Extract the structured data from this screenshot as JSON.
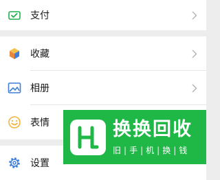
{
  "menu": {
    "items": [
      {
        "label": "支付",
        "icon": "wallet-check-icon",
        "color": "#21b24b"
      },
      {
        "label": "收藏",
        "icon": "cube-icon",
        "color": "#e8a23c"
      },
      {
        "label": "相册",
        "icon": "photo-icon",
        "color": "#3f7fd8"
      },
      {
        "label": "表情",
        "icon": "smiley-icon",
        "color": "#f0b43c"
      },
      {
        "label": "设置",
        "icon": "gear-icon",
        "color": "#3f7fd8"
      }
    ]
  },
  "watermark": {
    "title": "换换回收",
    "subtitle_chars": [
      "旧",
      "手",
      "机",
      "换",
      "钱"
    ],
    "brand_color": "#1fb847",
    "logo": "hh-logo"
  }
}
